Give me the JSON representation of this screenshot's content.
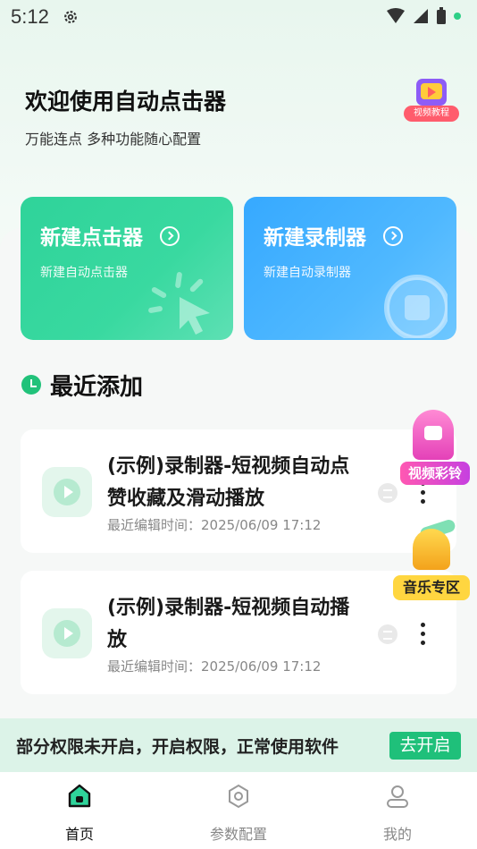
{
  "status_bar": {
    "time": "5:12"
  },
  "header": {
    "title": "欢迎使用自动点击器",
    "subtitle": "万能连点 多种功能随心配置",
    "tutorial_label": "视频教程"
  },
  "cards": [
    {
      "title": "新建点击器",
      "subtitle": "新建自动点击器",
      "color": "#2fd39a"
    },
    {
      "title": "新建录制器",
      "subtitle": "新建自动录制器",
      "color": "#36a9ff"
    }
  ],
  "recent": {
    "title": "最近添加",
    "items": [
      {
        "name": "(示例)录制器-短视频自动点赞收藏及滑动播放",
        "time": "最近编辑时间：2025/06/09 17:12"
      },
      {
        "name": "(示例)录制器-短视频自动播放",
        "time": "最近编辑时间：2025/06/09 17:12"
      }
    ]
  },
  "floats": {
    "ringtone_label": "视频彩铃",
    "music_label": "音乐专区"
  },
  "notice": {
    "text": "部分权限未开启，开启权限，正常使用软件",
    "button": "去开启"
  },
  "tabs": [
    {
      "label": "首页",
      "active": true
    },
    {
      "label": "参数配置",
      "active": false
    },
    {
      "label": "我的",
      "active": false
    }
  ],
  "colors": {
    "accent": "#1fc07a",
    "notice_bg": "#dcf3e8"
  }
}
